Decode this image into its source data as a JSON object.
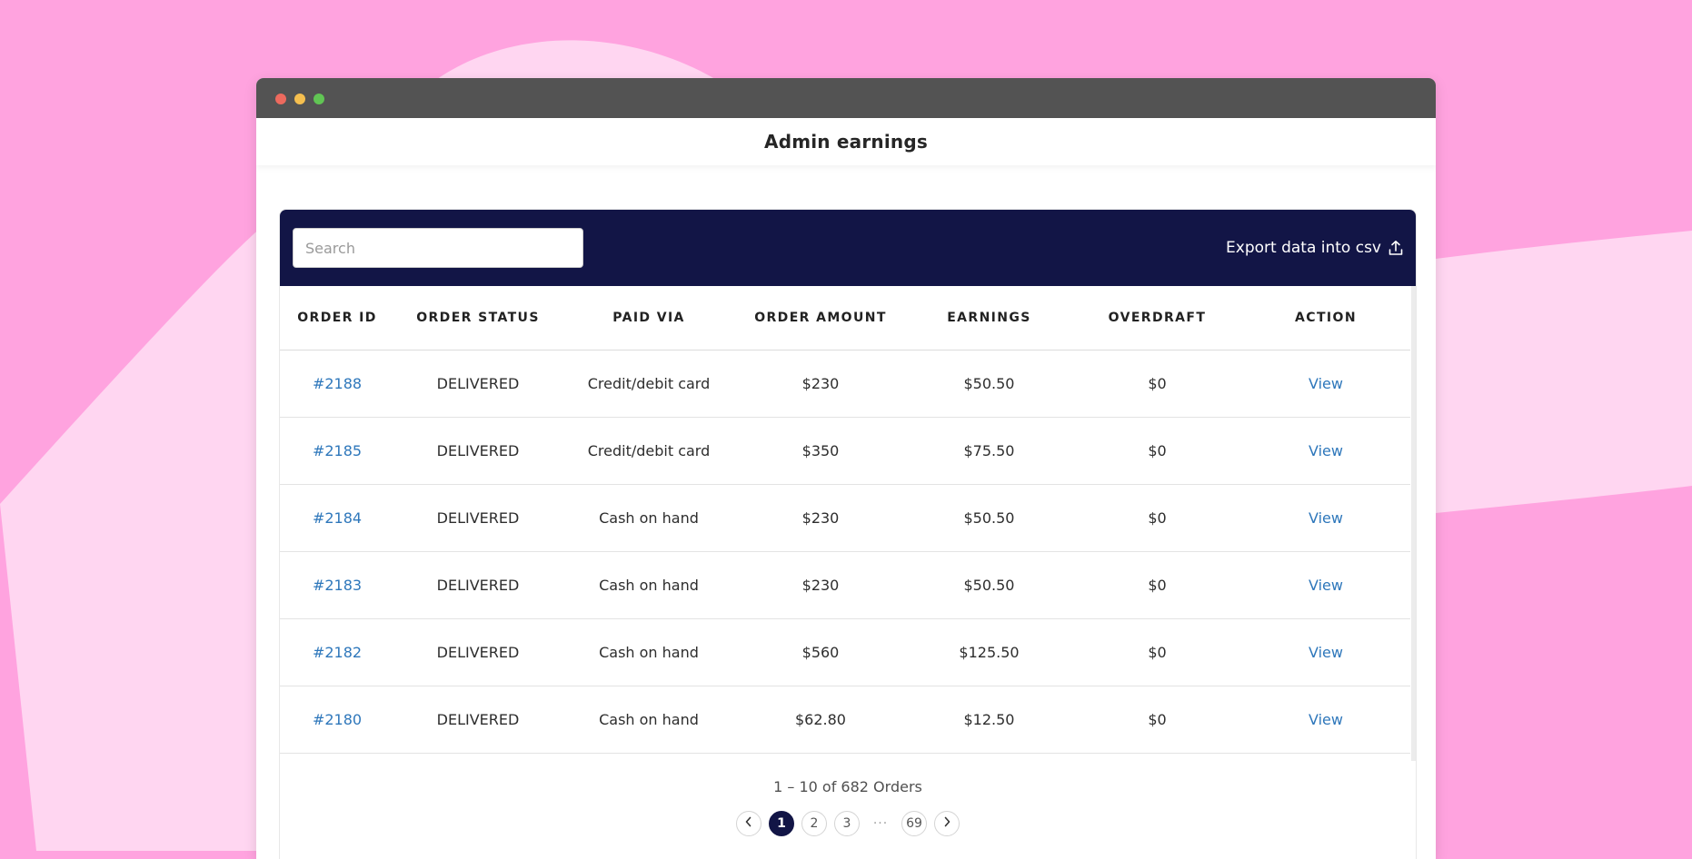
{
  "page": {
    "title": "Admin earnings"
  },
  "toolbar": {
    "search_placeholder": "Search",
    "export_label": "Export data into csv"
  },
  "table": {
    "columns": [
      "ORDER ID",
      "ORDER STATUS",
      "PAID VIA",
      "ORDER AMOUNT",
      "EARNINGS",
      "OVERDRAFT",
      "ACTION"
    ],
    "rows": [
      {
        "order_id": "#2188",
        "status": "DELIVERED",
        "paid_via": "Credit/debit card",
        "amount": "$230",
        "earnings": "$50.50",
        "overdraft": "$0",
        "action": "View"
      },
      {
        "order_id": "#2185",
        "status": "DELIVERED",
        "paid_via": "Credit/debit card",
        "amount": "$350",
        "earnings": "$75.50",
        "overdraft": "$0",
        "action": "View"
      },
      {
        "order_id": "#2184",
        "status": "DELIVERED",
        "paid_via": "Cash on hand",
        "amount": "$230",
        "earnings": "$50.50",
        "overdraft": "$0",
        "action": "View"
      },
      {
        "order_id": "#2183",
        "status": "DELIVERED",
        "paid_via": "Cash on hand",
        "amount": "$230",
        "earnings": "$50.50",
        "overdraft": "$0",
        "action": "View"
      },
      {
        "order_id": "#2182",
        "status": "DELIVERED",
        "paid_via": "Cash on hand",
        "amount": "$560",
        "earnings": "$125.50",
        "overdraft": "$0",
        "action": "View"
      },
      {
        "order_id": "#2180",
        "status": "DELIVERED",
        "paid_via": "Cash on hand",
        "amount": "$62.80",
        "earnings": "$12.50",
        "overdraft": "$0",
        "action": "View"
      }
    ]
  },
  "pagination": {
    "summary": "1 – 10 of 682 Orders",
    "pages": [
      "1",
      "2",
      "3"
    ],
    "ellipsis": "···",
    "last_page": "69",
    "current_page": "1"
  },
  "icons": {
    "window_controls": [
      "close-dot",
      "minimize-dot",
      "maximize-dot"
    ],
    "export": "upload-icon",
    "prev": "chevron-left-icon",
    "next": "chevron-right-icon"
  },
  "colors": {
    "background": "#ffa3df",
    "toolbar": "#121546",
    "link": "#2e77bb",
    "titlebar": "#535353"
  }
}
